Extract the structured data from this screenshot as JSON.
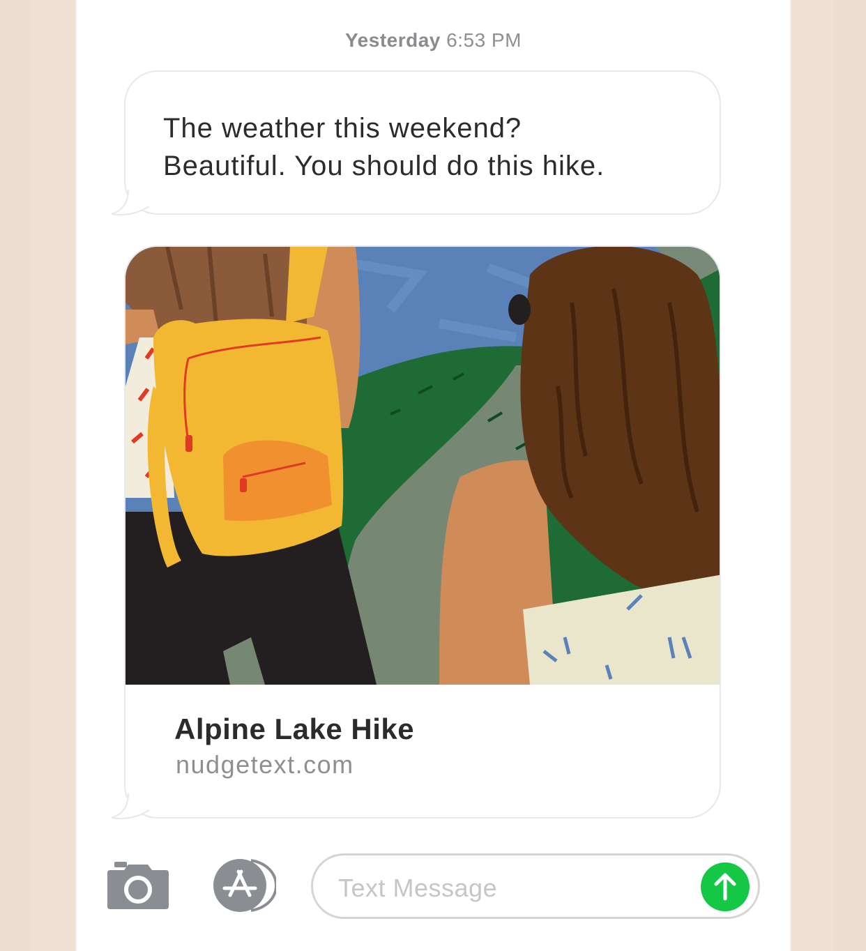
{
  "conversation": {
    "timestamp_day": "Yesterday",
    "timestamp_time": "6:53 PM",
    "message_text": "The weather this weekend?\nBeautiful. You should do this hike.",
    "link_preview": {
      "title": "Alpine Lake Hike",
      "domain": "nudgetext.com"
    }
  },
  "composer": {
    "placeholder": "Text Message",
    "camera_icon": "camera-icon",
    "apps_icon": "app-store-icon",
    "send_icon": "arrow-up-icon"
  },
  "colors": {
    "send_green": "#14c845",
    "bubble_border": "#e8e8ea",
    "frame_beige": "#ecdcd2"
  }
}
